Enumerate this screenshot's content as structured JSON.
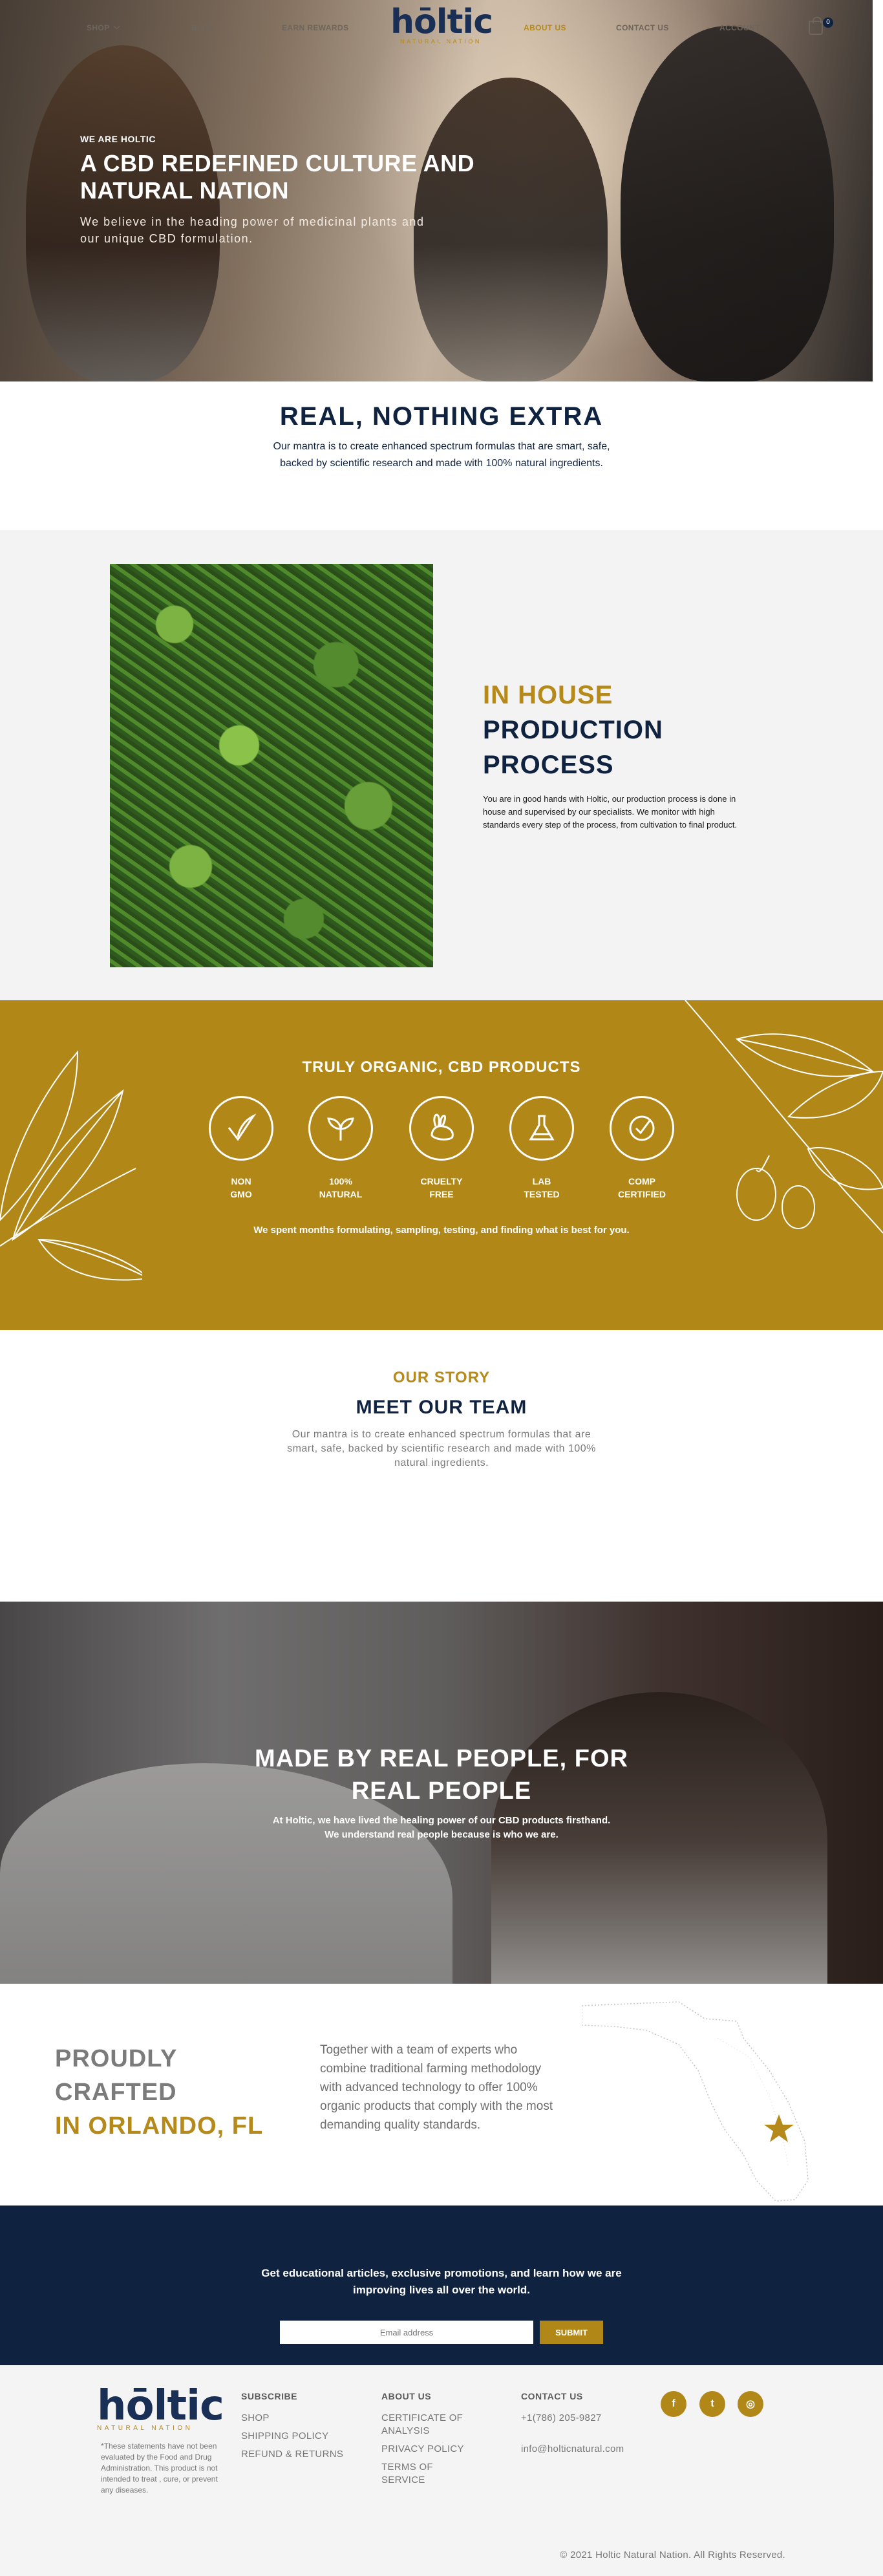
{
  "nav": {
    "shop": "SHOP",
    "blog": "BLOG",
    "earn_rewards": "EARN REWARDS",
    "about_us": "ABOUT US",
    "contact_us": "CONTACT US",
    "account": "ACCOUNT",
    "cart_count": "0"
  },
  "brand": {
    "name": "hōltic",
    "tagline": "NATURAL NATION"
  },
  "hero": {
    "eyebrow": "WE ARE HOLTIC",
    "title": "A CBD REDEFINED CULTURE AND NATURAL NATION",
    "text": "We believe in the heading power of medicinal plants and our unique CBD formulation."
  },
  "real": {
    "title": "REAL, NOTHING EXTRA",
    "text": "Our mantra is to create enhanced spectrum formulas that are smart, safe, backed by scientific research and made with 100% natural ingredients."
  },
  "inhouse": {
    "title_accent": "IN HOUSE",
    "title_main": "PRODUCTION PROCESS",
    "text": "You are in good hands with Holtic, our production process is done in house and supervised by our specialists. We monitor with high standards every step of the process, from cultivation to final product."
  },
  "organic": {
    "title": "TRULY ORGANIC, CBD PRODUCTS",
    "badges": [
      {
        "line1": "NON",
        "line2": "GMO",
        "icon": "check-leaf-icon"
      },
      {
        "line1": "100%",
        "line2": "NATURAL",
        "icon": "sprout-icon"
      },
      {
        "line1": "CRUELTY",
        "line2": "FREE",
        "icon": "rabbit-icon"
      },
      {
        "line1": "LAB",
        "line2": "TESTED",
        "icon": "flask-icon"
      },
      {
        "line1": "COMP",
        "line2": "CERTIFIED",
        "icon": "certified-check-icon"
      }
    ],
    "text": "We spent months formulating, sampling, testing, and finding what is best for you."
  },
  "story": {
    "eyebrow": "OUR STORY",
    "title": "MEET OUR TEAM",
    "text": "Our mantra is to create enhanced spectrum formulas that are smart, safe, backed by scientific research and made with 100% natural ingredients."
  },
  "people": {
    "title": "MADE BY REAL PEOPLE, FOR REAL PEOPLE",
    "text": "At Holtic, we have lived the healing power of our CBD products firsthand. We understand real people because is who we are."
  },
  "orlando": {
    "line1": "PROUDLY",
    "line2": "CRAFTED",
    "line3": "IN ORLANDO, FL",
    "text": "Together with a team of experts who combine traditional farming methodology with advanced technology to offer 100% organic products that comply with the most demanding quality standards."
  },
  "newsletter": {
    "text": "Get educational articles, exclusive promotions, and learn how we are improving lives all over the world.",
    "placeholder": "Email address",
    "submit": "SUBMIT"
  },
  "footer": {
    "disclaimer": "*These statements have not been evaluated by the Food and Drug Administration. This product is not intended to treat , cure, or prevent any diseases.",
    "col1": {
      "heading": "SUBSCRIBE",
      "links": [
        "SHOP",
        "SHIPPING POLICY",
        "REFUND & RETURNS"
      ]
    },
    "col2": {
      "heading": "ABOUT US",
      "links": [
        "CERTIFICATE OF ANALYSIS",
        "PRIVACY POLICY",
        "TERMS OF SERVICE"
      ]
    },
    "col3": {
      "heading": "CONTACT US",
      "phone": "+1(786) 205-9827",
      "email": "info@holticnatural.com"
    },
    "social": [
      {
        "glyph": "f",
        "icon": "facebook-icon"
      },
      {
        "glyph": "t",
        "icon": "twitter-icon"
      },
      {
        "glyph": "◎",
        "icon": "instagram-icon"
      }
    ],
    "copyright": "© 2021 Holtic Natural Nation. All Rights Reserved."
  },
  "colors": {
    "navy": "#0f2340",
    "gold": "#b18718",
    "gray": "#7b7b7b"
  }
}
